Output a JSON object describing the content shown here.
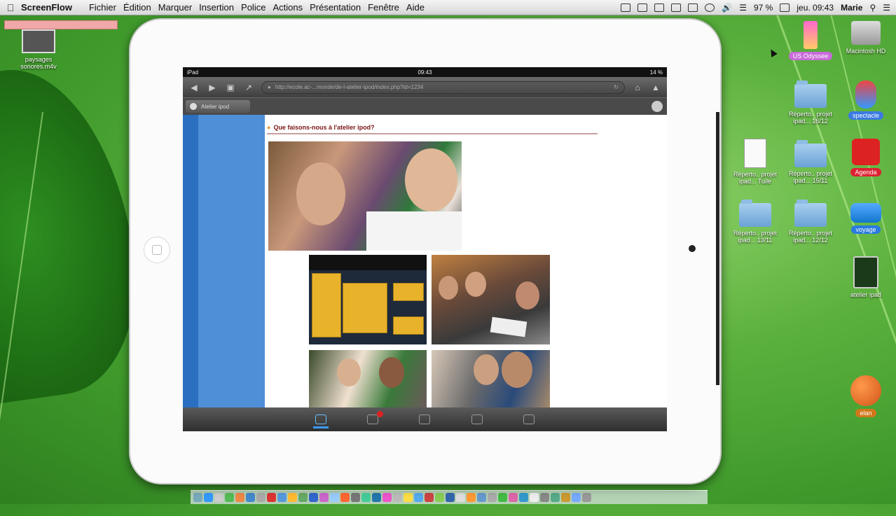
{
  "menubar": {
    "app": "ScreenFlow",
    "items": [
      "Fichier",
      "Édition",
      "Marquer",
      "Insertion",
      "Police",
      "Actions",
      "Présentation",
      "Fenêtre",
      "Aide"
    ],
    "battery": "97 %",
    "clock": "jeu. 09:43",
    "user": "Marie"
  },
  "desktop": {
    "left_file": "paysages sonores.m4v",
    "icons": {
      "us_odyssee": "US Odyssee",
      "macintosh_hd": "Macintosh HD",
      "folder_1": "Réperto.. projet ipad... 16/12",
      "spectacle": "spectacle",
      "doc_1": "Réperto.. projet ipad... Tuile",
      "folder_2": "Réperto.. projet ipad... 15/11",
      "agenda": "Agenda",
      "folder_3": "Réperto.. projet ipad... 13/11",
      "folder_4": "Réperto.. projet ipad... 12/12",
      "voyage": "voyage",
      "atelier_ipad": "atelier ipad",
      "elan": "elan"
    }
  },
  "ipad": {
    "status": {
      "left": "iPad",
      "time": "09:43",
      "right": "14 %"
    },
    "url": "http://ecole.ac-...monde/de-l-atelier-ipod/index.php?id=1234",
    "tab_title": "Atelier ipod",
    "heading": "Que faisons-nous à l'atelier ipod?"
  },
  "colors": {
    "sidebar_dark": "#2a6fc0",
    "sidebar_light": "#4f8fd8",
    "heading": "#7a1515",
    "active_tab": "#3a9aff"
  }
}
